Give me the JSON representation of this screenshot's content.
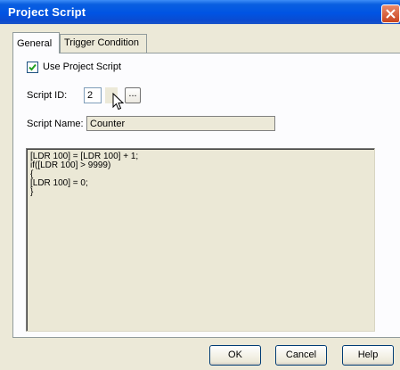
{
  "window": {
    "title": "Project Script"
  },
  "tabs": [
    {
      "label": "General"
    },
    {
      "label": "Trigger Condition"
    }
  ],
  "general": {
    "use_script_label": "Use Project Script",
    "use_script_checked": true,
    "script_id_label": "Script ID:",
    "script_id_value": "2",
    "browse_label": "...",
    "script_name_label": "Script Name:",
    "script_name_value": "Counter",
    "script_code": "[LDR 100] = [LDR 100] + 1;\nif([LDR 100] > 9999)\n{\n[LDR 100] = 0;\n}"
  },
  "buttons": {
    "ok": "OK",
    "cancel": "Cancel",
    "help": "Help"
  },
  "icons": {
    "close": "close-icon",
    "cursor": "mouse-pointer-icon",
    "check": "checkmark-icon"
  },
  "colors": {
    "titlebar": "#0054e3",
    "dialog_bg": "#ece9d8",
    "close_button": "#c9441f"
  }
}
